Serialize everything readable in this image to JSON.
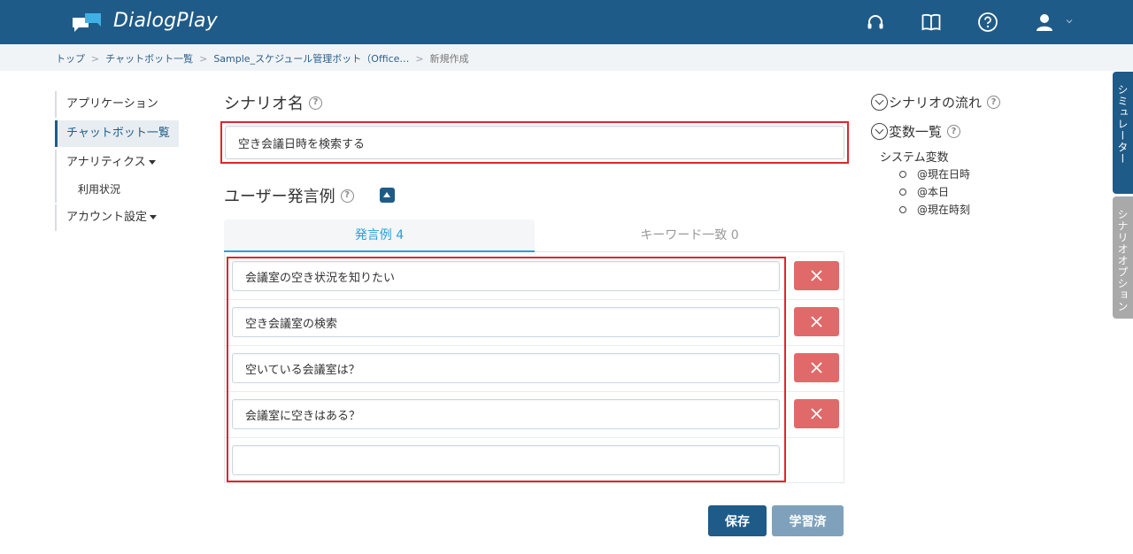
{
  "app": {
    "name": "DialogPlay"
  },
  "header": {
    "icons": [
      "headset-icon",
      "book-icon",
      "help-circle-icon",
      "user-icon"
    ]
  },
  "breadcrumb": {
    "items": [
      "トップ",
      "チャットボット一覧",
      "Sample_スケジュール管理ボット（Office…"
    ],
    "current": "新規作成"
  },
  "sidebar": {
    "items": [
      {
        "label": "アプリケーション"
      },
      {
        "label": "チャットボット一覧",
        "active": true
      },
      {
        "label": "アナリティクス"
      },
      {
        "label": "利用状況"
      },
      {
        "label": "アカウント設定"
      }
    ]
  },
  "scenario": {
    "title": "シナリオ名",
    "help_glyph": "?",
    "name_value": "空き会議日時を検索する"
  },
  "examples": {
    "title": "ユーザー発言例",
    "tabs": [
      {
        "label": "発言例 4",
        "active": true
      },
      {
        "label": "キーワード一致 0",
        "active": false
      }
    ],
    "rows": [
      "会議室の空き状況を知りたい",
      "空き会議室の検索",
      "空いている会議室は？",
      "会議室に空きはある？",
      ""
    ]
  },
  "actions": {
    "save": "保存",
    "learned": "学習済"
  },
  "right_panel": {
    "flow_label": "シナリオの流れ",
    "vars_label": "変数一覧",
    "system_vars_label": "システム変数",
    "system_vars": [
      "@現在日時",
      "@本日",
      "@現在時刻"
    ]
  },
  "side_tabs": {
    "simulator": "シミュレーター",
    "options": "シナリオオプション"
  },
  "colors": {
    "header": "#1f5b88",
    "accent": "#29a0d8",
    "delete": "#e06a6a",
    "highlight": "#e0262b"
  }
}
